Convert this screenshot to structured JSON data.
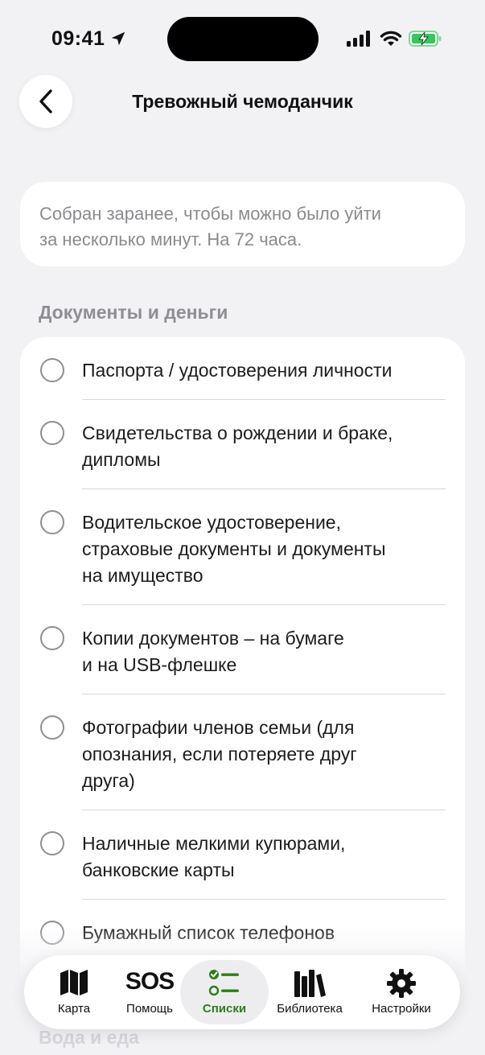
{
  "status": {
    "time": "09:41"
  },
  "header": {
    "title": "Тревожный чемоданчик"
  },
  "intro": {
    "line1": "Собран заранее, чтобы можно было уйти",
    "line2": "за несколько минут. На 72 часа."
  },
  "section": {
    "title": "Документы и деньги",
    "items": [
      {
        "lines": [
          "Паспорта / удостоверения личности"
        ],
        "checked": false
      },
      {
        "lines": [
          "Свидетельства о рождении и браке,",
          "дипломы"
        ],
        "checked": false
      },
      {
        "lines": [
          "Водительское удостоверение,",
          "страховые документы и документы",
          "на имущество"
        ],
        "checked": false
      },
      {
        "lines": [
          "Копии документов – на бумаге",
          "и на USB-флешке"
        ],
        "checked": false
      },
      {
        "lines": [
          "Фотографии членов семьи (для",
          "опознания, если потеряете друг",
          "друга)"
        ],
        "checked": false
      },
      {
        "lines": [
          "Наличные мелкими купюрами,",
          "банковские карты"
        ],
        "checked": false
      },
      {
        "lines": [
          "Бумажный список телефонов"
        ],
        "checked": false
      }
    ]
  },
  "next_section": {
    "title": "Вода и еда"
  },
  "tab_bar": {
    "tabs": [
      {
        "label": "Карта",
        "icon": "map-icon"
      },
      {
        "label": "Помощь",
        "icon": "sos-icon",
        "icon_text": "SOS"
      },
      {
        "label": "Списки",
        "icon": "checklist-icon",
        "active": true
      },
      {
        "label": "Библиотека",
        "icon": "books-icon"
      },
      {
        "label": "Настройки",
        "icon": "gear-icon"
      }
    ]
  },
  "colors": {
    "accent": "#2e7d1a",
    "background": "#f2f2f5",
    "battery": "#34c759"
  }
}
